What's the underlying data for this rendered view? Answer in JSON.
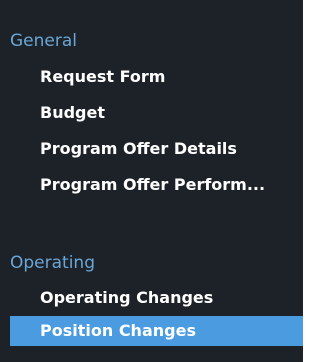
{
  "sections": [
    {
      "title": "General",
      "items": [
        {
          "label": "Request Form"
        },
        {
          "label": "Budget"
        },
        {
          "label": "Program Offer Details"
        },
        {
          "label": "Program Offer Perform..."
        }
      ]
    },
    {
      "title": "Operating",
      "items": [
        {
          "label": "Operating Changes"
        },
        {
          "label": "Position Changes",
          "selected": true
        }
      ]
    }
  ],
  "colors": {
    "background": "#1d2229",
    "section_title": "#6aa6d6",
    "item_text": "#ffffff",
    "selected_background": "#4a9be0"
  }
}
